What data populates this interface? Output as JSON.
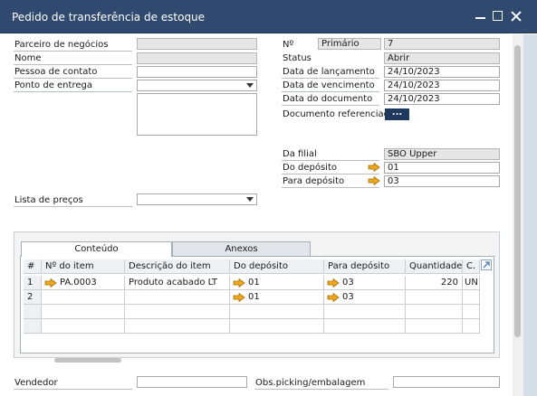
{
  "window": {
    "title": "Pedido de transferência de estoque"
  },
  "left_fields": {
    "parceiro_label": "Parceiro de negócios",
    "nome_label": "Nome",
    "pessoa_label": "Pessoa de contato",
    "ponto_label": "Ponto de entrega",
    "lista_label": "Lista de preços"
  },
  "right_fields": {
    "no_label": "Nº",
    "no_series": "Primário",
    "no_value": "7",
    "status_label": "Status",
    "status_value": "Abrir",
    "data_lanc_label": "Data de lançamento",
    "data_lanc_value": "24/10/2023",
    "data_venc_label": "Data de vencimento",
    "data_venc_value": "24/10/2023",
    "data_doc_label": "Data do documento",
    "data_doc_value": "24/10/2023",
    "doc_ref_label": "Documento referenciado",
    "doc_ref_button": "...",
    "filial_label": "Da filial",
    "filial_value": "SBO Upper",
    "do_deposito_label": "Do depósito",
    "do_deposito_value": "01",
    "para_deposito_label": "Para depósito",
    "para_deposito_value": "03"
  },
  "tabs": [
    {
      "label": "Conteúdo",
      "active": true
    },
    {
      "label": "Anexos",
      "active": false
    }
  ],
  "grid": {
    "columns": [
      "#",
      "Nº do item",
      "Descrição do item",
      "Do depósito",
      "Para depósito",
      "Quantidade",
      "C."
    ],
    "rows": [
      {
        "num": "1",
        "item": "PA.0003",
        "descricao": "Produto acabado LT",
        "do_deposito": "01",
        "para_deposito": "03",
        "quantidade": "220",
        "c": "UN"
      },
      {
        "num": "2",
        "item": "",
        "descricao": "",
        "do_deposito": "01",
        "para_deposito": "03",
        "quantidade": "",
        "c": ""
      }
    ]
  },
  "footer": {
    "vendedor_label": "Vendedor",
    "obs_label": "Obs.picking/embalagem"
  },
  "colors": {
    "titlebar": "#2f4a6e",
    "arrow_fill": "#f0a91e",
    "arrow_stroke": "#a86a00",
    "button": "#1f3a5f"
  },
  "icons": {
    "link_arrow": "orange-right-arrow-icon",
    "expand": "expand-diagonal-icon",
    "dropdown": "chevron-down-icon"
  }
}
